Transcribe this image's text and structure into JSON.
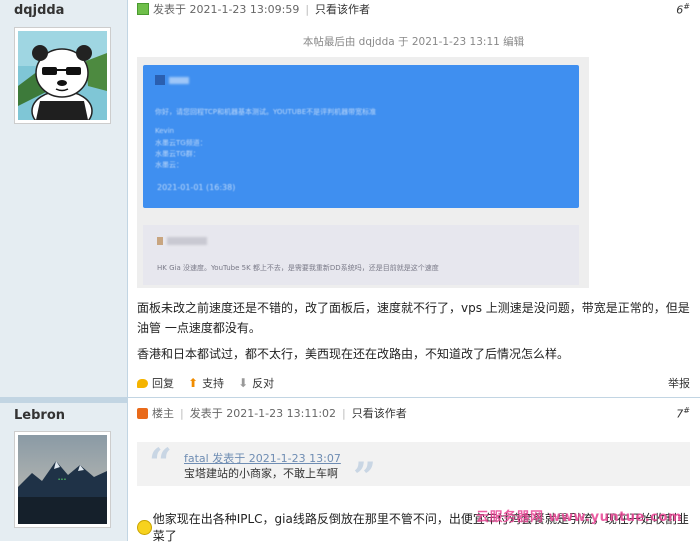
{
  "post1": {
    "author": "dqjdda",
    "posted": "发表于 2021-1-23 13:09:59",
    "only_author": "只看该作者",
    "floor": "6",
    "floor_suffix": "#",
    "edit_note": "本帖最后由 dqjdda 于 2021-1-23 13:11 编辑",
    "image": {
      "greeting": "你好，请您回程TCP和机器基本测试。YOUTUBE不是评判机器带宽标准",
      "name": "Kevin",
      "line1": "水墨云TG频道：",
      "line2": "水墨云TG群：",
      "line3": "水墨云：",
      "date": "2021-01-01 (16:38)",
      "grey_line": "HK Gia 没速度。YouTube 5K 都上不去，是需要我重新DD系统吗，还是目前就是这个速度"
    },
    "paragraph1": "面板未改之前速度还是不错的，改了面板后，速度就不行了，vps 上测速是没问题，带宽是正常的，但是 油管 一点速度都没有。",
    "paragraph2": "香港和日本都试过，都不太行，美西现在还在改路由，不知道改了后情况怎么样。",
    "actions": {
      "reply": "回复",
      "support": "支持",
      "oppose": "反对",
      "report": "举报"
    }
  },
  "post2": {
    "author": "Lebron",
    "role": "楼主",
    "posted": "发表于 2021-1-23 13:11:02",
    "only_author": "只看该作者",
    "floor": "7",
    "floor_suffix": "#",
    "quote_author": "fatal 发表于 2021-1-23 13:07",
    "quote_text": "宝塔建站的小商家，不敢上车啊",
    "reply_text": "他家现在出各种IPLC，gia线路反倒放在那里不管不问，出便宜年付鸡套餐就是引流，现在开始收割韭菜了"
  },
  "watermark": "云服务器网 www.yuntue.com",
  "colors": {
    "sidebar_bg": "#e5edf2",
    "border": "#c2d5e3",
    "card_blue": "#3f8ff0",
    "watermark": "#e84393"
  }
}
